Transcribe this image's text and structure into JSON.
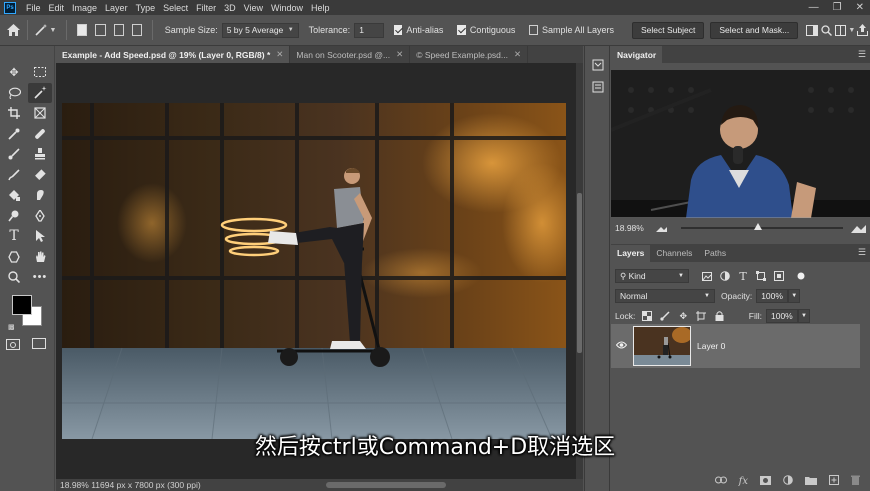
{
  "app": {
    "logo": "Ps"
  },
  "menu": [
    "File",
    "Edit",
    "Image",
    "Layer",
    "Type",
    "Select",
    "Filter",
    "3D",
    "View",
    "Window",
    "Help"
  ],
  "window_controls": [
    "minimize-icon",
    "restore-icon",
    "close-icon"
  ],
  "options": {
    "sample_size_label": "Sample Size:",
    "sample_size_value": "5 by 5 Average",
    "tolerance_label": "Tolerance:",
    "tolerance_value": "1",
    "anti_alias_label": "Anti-alias",
    "anti_alias_checked": true,
    "contiguous_label": "Contiguous",
    "contiguous_checked": true,
    "sample_all_layers_label": "Sample All Layers",
    "sample_all_layers_checked": false,
    "select_subject_label": "Select Subject",
    "select_mask_label": "Select and Mask..."
  },
  "tabs": [
    {
      "label": "Example - Add Speed.psd @ 19% (Layer 0, RGB/8) *",
      "active": true
    },
    {
      "label": "Man on Scooter.psd @...",
      "active": false
    },
    {
      "label": "© Speed Example.psd...",
      "active": false
    }
  ],
  "status_bar": "18.98%  11694 px x 7800 px (300 ppi)",
  "subtitle": "然后按ctrl或Command+D取消选区",
  "navigator": {
    "title": "Navigator",
    "zoom": "18.98%",
    "zoom_fraction": 0.45
  },
  "layers_panel": {
    "tabs": [
      "Layers",
      "Channels",
      "Paths"
    ],
    "filter_kind": "Kind",
    "blend_mode": "Normal",
    "opacity_label": "Opacity:",
    "opacity_value": "100%",
    "lock_label": "Lock:",
    "fill_label": "Fill:",
    "fill_value": "100%",
    "layer_name": "Layer 0"
  },
  "colors": {
    "fg": "#000000",
    "bg": "#ffffff",
    "accent": "#31a8ff"
  }
}
